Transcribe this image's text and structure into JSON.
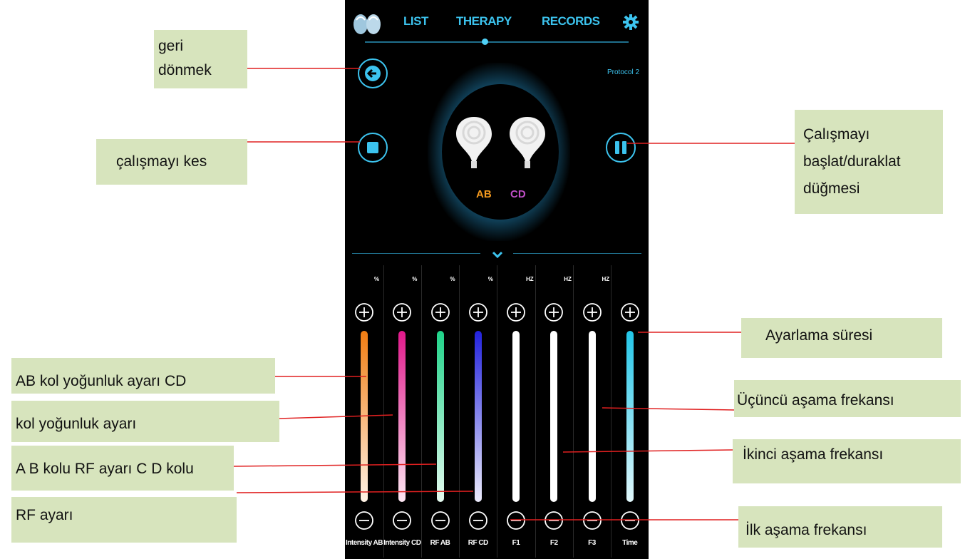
{
  "nav": {
    "list_label": "LIST",
    "therapy_label": "THERAPY",
    "records_label": "RECORDS"
  },
  "header": {
    "protocol_label": "Protocol 2"
  },
  "device": {
    "ab_label": "AB",
    "cd_label": "CD"
  },
  "channels": [
    {
      "label": "Intensity AB",
      "unit": "%",
      "color_top": "#f07c12",
      "color_bottom": "#fff3e6"
    },
    {
      "label": "Intensity CD",
      "unit": "%",
      "color_top": "#e0188a",
      "color_bottom": "#fde6f2"
    },
    {
      "label": "RF AB",
      "unit": "%",
      "color_top": "#1fd389",
      "color_bottom": "#e6fbf0"
    },
    {
      "label": "RF CD",
      "unit": "%",
      "color_top": "#2222dd",
      "color_bottom": "#ecebfb"
    },
    {
      "label": "F1",
      "unit": "HZ",
      "color_top": "#ffffff",
      "color_bottom": "#ffffff"
    },
    {
      "label": "F2",
      "unit": "HZ",
      "color_top": "#ffffff",
      "color_bottom": "#ffffff"
    },
    {
      "label": "F3",
      "unit": "HZ",
      "color_top": "#ffffff",
      "color_bottom": "#ffffff"
    },
    {
      "label": "Time",
      "unit": "",
      "color_top": "#22c6e8",
      "color_bottom": "#e2f8fc"
    }
  ],
  "annotations": {
    "geri_line1": "geri",
    "geri_line2": "dönmek",
    "stop": "çalışmayı kes",
    "start_line1": "Çalışmayı",
    "start_line2": "başlat/duraklat",
    "start_line3": "düğmesi",
    "time": "Ayarlama süresi",
    "intensity_ab": "AB kol yoğunluk ayarı CD",
    "intensity_cd": "kol yoğunluk ayarı",
    "f3": "Üçüncü aşama frekansı",
    "f2": "İkinci aşama frekansı",
    "rf_ab": "A B kolu RF ayarı C D kolu",
    "rf_cd": "RF ayarı",
    "f1": "İlk aşama frekansı"
  },
  "colors": {
    "accent": "#3cc3ee",
    "annotation_bg": "#d7e4bd",
    "leader_line": "#e02020"
  }
}
